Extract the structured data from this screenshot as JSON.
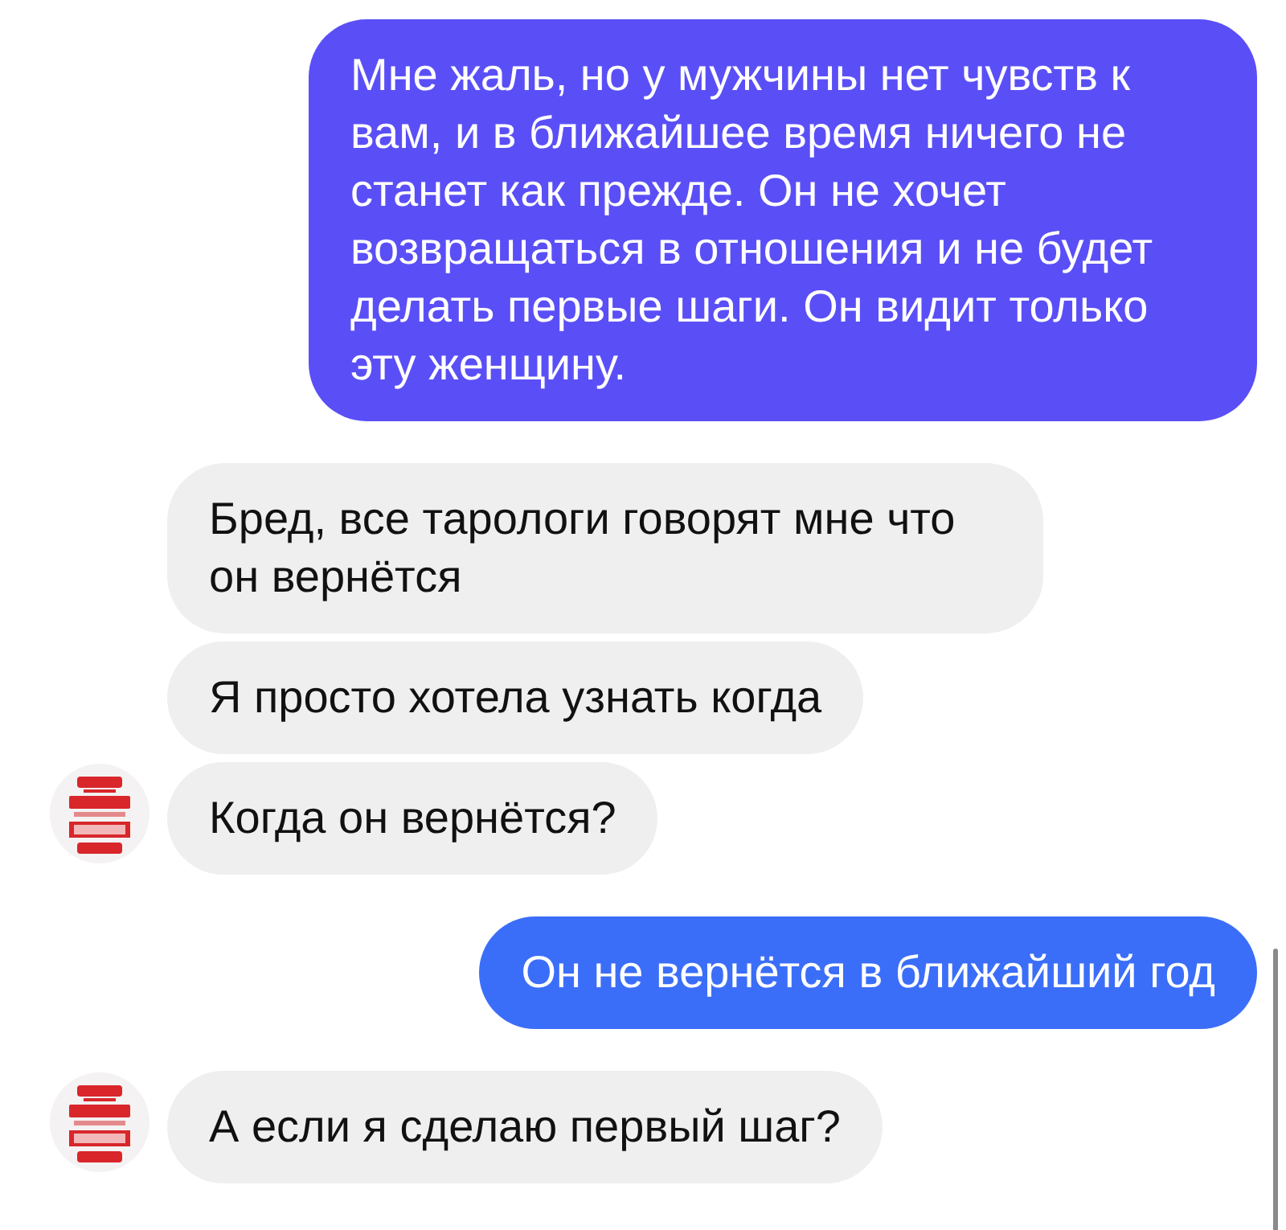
{
  "messages": [
    {
      "kind": "outgoing",
      "color": "#5a4ff6",
      "text": "Мне жаль, но у мужчины нет чувств к вам, и в ближайшее время ничего не станет как прежде. Он не хочет возвращаться в отношения и не будет делать первые шаги. Он видит только эту женщину."
    },
    {
      "kind": "incoming",
      "avatar": false,
      "text": "Бред, все тарологи говорят мне что он вернётся"
    },
    {
      "kind": "incoming",
      "avatar": false,
      "text": "Я просто хотела узнать когда"
    },
    {
      "kind": "incoming",
      "avatar": true,
      "text": "Когда он вернётся?"
    },
    {
      "kind": "outgoing",
      "color": "#3b6ef8",
      "text": "Он не вернётся в ближайший год"
    },
    {
      "kind": "incoming",
      "avatar": true,
      "text": "А если я сделаю первый шаг?"
    }
  ]
}
